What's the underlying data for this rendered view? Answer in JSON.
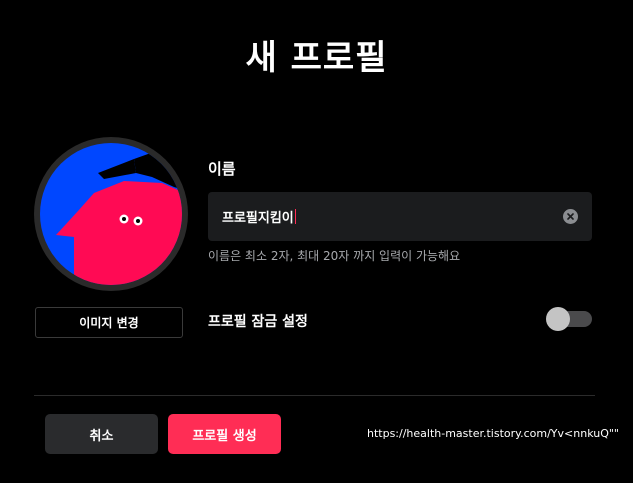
{
  "page": {
    "title": "새 프로필"
  },
  "avatar": {
    "change_label": "이미지 변경",
    "colors": {
      "ring": "#2a2a2a",
      "background": "#0047ff",
      "character": "#ff0a54",
      "cap": "#000000"
    }
  },
  "name": {
    "label": "이름",
    "value": "프로필지킴이",
    "helper": "이름은 최소 2자, 최대 20자 까지 입력이 가능해요"
  },
  "lock": {
    "label": "프로필 잠금 설정",
    "enabled": false
  },
  "actions": {
    "cancel_label": "취소",
    "create_label": "프로필 생성"
  },
  "footer": {
    "url": "https://health-master.tistory.com/Yv<nnkuQ\"\""
  },
  "colors": {
    "accent": "#ff2d55",
    "input_bg": "#1b1c1e",
    "secondary_button": "#2a2b2d"
  }
}
